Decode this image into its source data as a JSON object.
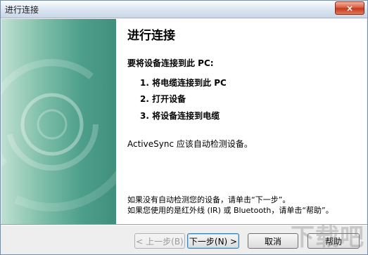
{
  "window": {
    "title": "进行连接",
    "close_symbol": "×"
  },
  "content": {
    "heading": "进行连接",
    "intro": "要将设备连接到此 PC:",
    "steps": [
      "1. 将电缆连接到此 PC",
      "2. 打开设备",
      "3. 将设备连接到电缆"
    ],
    "auto_detect": "ActiveSync 应该自动检测设备。",
    "hint_line1": "如果没有自动检测您的设备，请单击“下一步”。",
    "hint_line2": "如果您使用的是红外线 (IR) 或 Bluetooth，请单击“帮助”。"
  },
  "buttons": {
    "back": "< 上一步(B)",
    "next": "下一步(N) >",
    "cancel": "取消",
    "help": "帮助"
  },
  "watermark": "下载吧",
  "colors": {
    "banner_dark": "#3f8f7c",
    "banner_light": "#bfe0d2",
    "close_red": "#c0391e"
  }
}
